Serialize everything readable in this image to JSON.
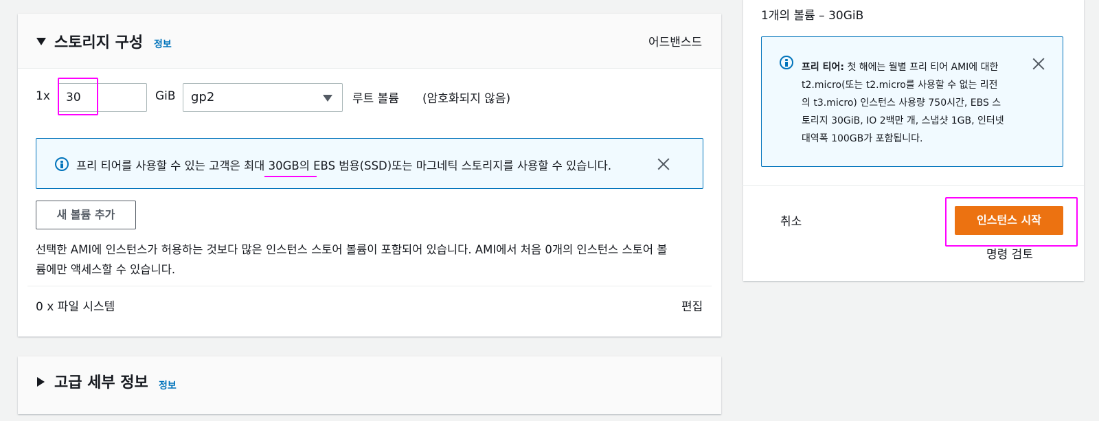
{
  "storage": {
    "title": "스토리지 구성",
    "info": "정보",
    "advanced_link": "어드밴스드",
    "multiplier": "1x",
    "size_value": "30",
    "unit": "GiB",
    "volume_type": "gp2",
    "root_label": "루트 볼륨",
    "encryption": "(암호화되지 않음)",
    "alert_text": "프리 티어를 사용할 수 있는 고객은 최대 30GB의 EBS 범용(SSD)또는 마그네틱 스토리지를 사용할 수 있습니다.",
    "add_volume": "새 볼륨 추가",
    "note_line1": "선택한 AMI에 인스턴스가 허용하는 것보다 많은 인스턴스 스토어 볼륨이 포함되어 있습니다. AMI에서 처음 0개의 인스턴스 스토어 볼",
    "note_line2": "륨에만 액세스할 수 있습니다.",
    "filesystem": "0 x 파일 시스템",
    "edit": "편집"
  },
  "advanced": {
    "title": "고급 세부 정보",
    "info": "정보"
  },
  "summary": {
    "volume_summary": "1개의 볼륨 – 30GiB",
    "free_tier_title": "프리 티어:",
    "free_tier_lines": [
      "첫 해에는 월별 프리 티어 AMI에 대한",
      "t2.micro(또는 t2.micro를 사용할 수 없는 리전",
      "의 t3.micro) 인스턴스 사용량 750시간, EBS 스",
      "토리지 30GiB, IO 2백만 개, 스냅샷 1GB, 인터넷",
      "대역폭 100GB가 포함됩니다."
    ],
    "cancel": "취소",
    "launch": "인스턴스 시작",
    "review": "명령 검토"
  },
  "colors": {
    "primary": "#ec7211",
    "link": "#0073bb",
    "highlight": "#ff00ff",
    "alert_bg": "#f1faff"
  }
}
